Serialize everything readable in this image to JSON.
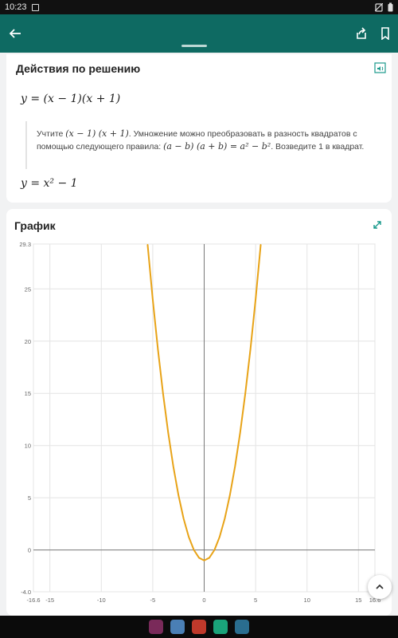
{
  "status_bar": {
    "time": "10:23"
  },
  "app_bar": {
    "back_icon": "arrow-left-icon",
    "share_icon": "share-icon",
    "bookmark_icon": "bookmark-icon"
  },
  "steps_card": {
    "title": "Действия по решению",
    "equation_1": "y = (x − 1)(x + 1)",
    "note": {
      "part1": "Учтите ",
      "expr1": "(x − 1) (x + 1)",
      "part2": ". Умножение можно преобразовать в разность квадратов с помощью следующего правила: ",
      "expr2": "(a − b) (a + b) = a² − b²",
      "part3": ". Возведите 1 в квадрат."
    },
    "equation_2": "y = x² − 1"
  },
  "graph_card": {
    "title": "График"
  },
  "colors": {
    "header": "#0e6a62",
    "curve": "#e8a317",
    "accent": "#1a9a8c"
  },
  "chart_data": {
    "type": "line",
    "title": "График",
    "xlabel": "",
    "ylabel": "",
    "xlim": [
      -16.6,
      16.6
    ],
    "ylim": [
      -4.0,
      29.3
    ],
    "x_ticks": [
      "-16.6",
      "-15",
      "-10",
      "-5",
      "0",
      "5",
      "10",
      "15",
      "16.6"
    ],
    "y_ticks": [
      "29.3",
      "25",
      "20",
      "15",
      "10",
      "5",
      "0",
      "-4.0"
    ],
    "grid": true,
    "series": [
      {
        "function": "y = x^2 - 1",
        "x": [
          -5.5,
          -5,
          -4.5,
          -4,
          -3.5,
          -3,
          -2.5,
          -2,
          -1.5,
          -1,
          -0.5,
          0,
          0.5,
          1,
          1.5,
          2,
          2.5,
          3,
          3.5,
          4,
          4.5,
          5,
          5.5
        ],
        "y": [
          29.25,
          24,
          19.25,
          15,
          11.25,
          8,
          5.25,
          3,
          1.25,
          0,
          -0.75,
          -1,
          -0.75,
          0,
          1.25,
          3,
          5.25,
          8,
          11.25,
          15,
          19.25,
          24,
          29.25
        ]
      }
    ]
  },
  "nav_bar": {
    "apps": [
      "app-icon-1",
      "app-icon-2",
      "app-icon-3",
      "app-icon-4",
      "app-icon-5"
    ]
  }
}
